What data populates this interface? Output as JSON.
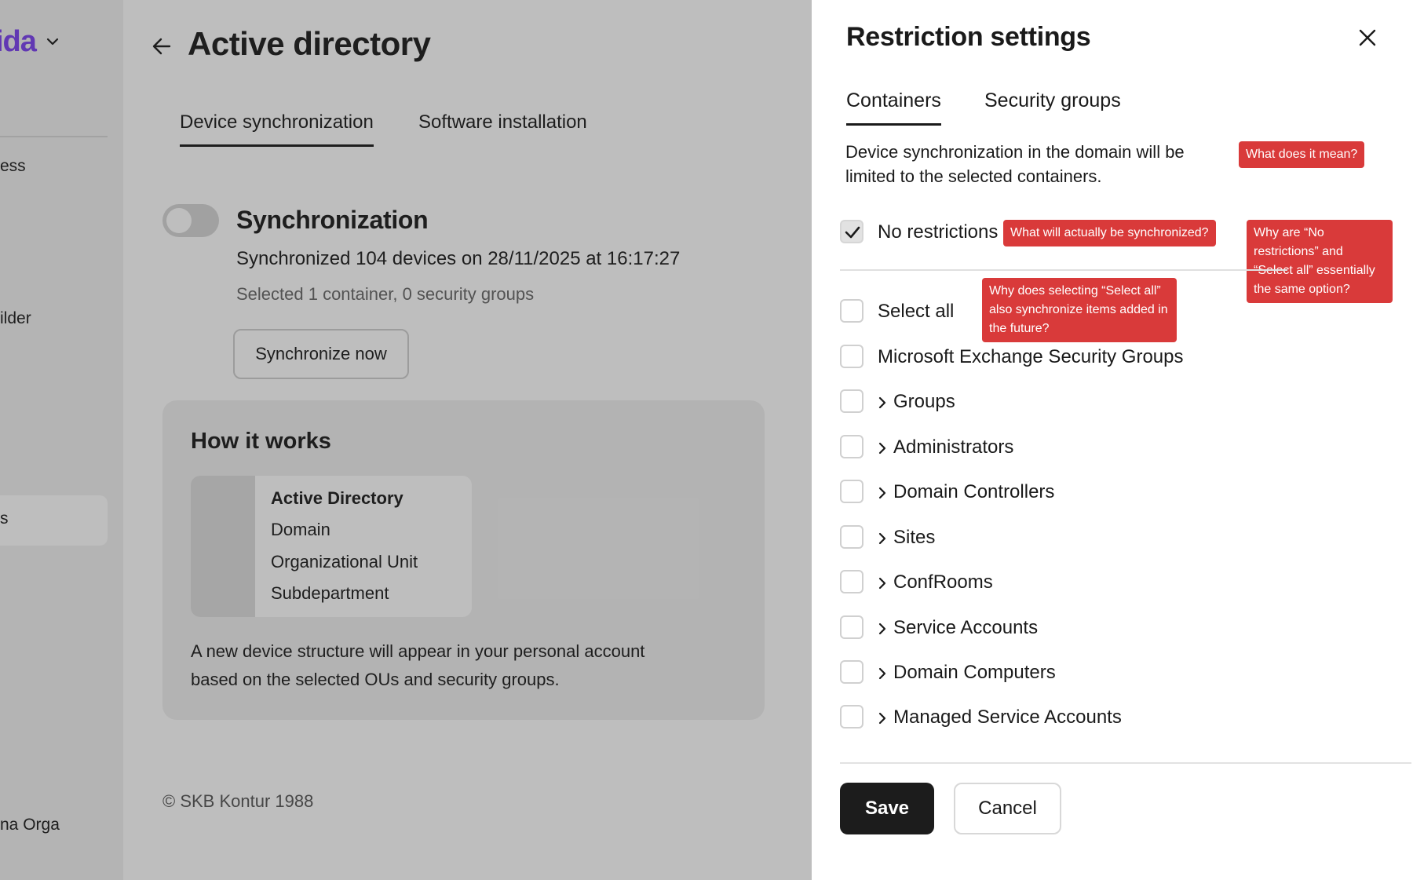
{
  "sidebar": {
    "brand": "ida",
    "items": [
      {
        "label": "ess"
      },
      {
        "label": "ilder"
      },
      {
        "label": "s"
      },
      {
        "label": "na Orga"
      }
    ]
  },
  "main": {
    "title": "Active directory",
    "tabs": [
      {
        "label": "Device synchronization"
      },
      {
        "label": "Software installation"
      }
    ],
    "sync": {
      "title": "Synchronization",
      "info": "Synchronized 104 devices on 28/11/2025 at 16:17:27",
      "selection": "Selected 1 container, 0 security groups",
      "button": "Synchronize now"
    },
    "how": {
      "title": "How it works",
      "tree": [
        "Active Directory",
        "Domain",
        "Organizational Unit",
        "Subdepartment"
      ],
      "description": "A new device structure will appear in your personal account based on the selected OUs and security groups."
    },
    "copyright": "© SKB Kontur 1988"
  },
  "panel": {
    "title": "Restriction settings",
    "tabs": [
      {
        "label": "Containers"
      },
      {
        "label": "Security groups"
      }
    ],
    "description": "Device synchronization in the domain will be limited to the selected containers.",
    "no_restrictions": {
      "label": "No restrictions",
      "checked": true
    },
    "select_all": {
      "label": "Select all",
      "checked": false
    },
    "items": [
      {
        "label": "Microsoft Exchange Security Groups",
        "expandable": false
      },
      {
        "label": "Groups",
        "expandable": true
      },
      {
        "label": "Administrators",
        "expandable": true
      },
      {
        "label": "Domain Controllers",
        "expandable": true
      },
      {
        "label": "Sites",
        "expandable": true
      },
      {
        "label": "ConfRooms",
        "expandable": true
      },
      {
        "label": "Service Accounts",
        "expandable": true
      },
      {
        "label": "Domain Computers",
        "expandable": true
      },
      {
        "label": "Managed Service Accounts",
        "expandable": true
      }
    ],
    "save": "Save",
    "cancel": "Cancel"
  },
  "annotations": {
    "meaning": "What does it mean?",
    "synced": "What will actually be synchronized?",
    "same_option": "Why are “No restrictions” and “Select all” essentially the same option?",
    "future_items": "Why does selecting “Select all” also synchronize items added in the future?"
  },
  "colors": {
    "brand": "#7a3ff0",
    "annotation": "#d93a3a",
    "primary_button": "#1c1c1c"
  }
}
